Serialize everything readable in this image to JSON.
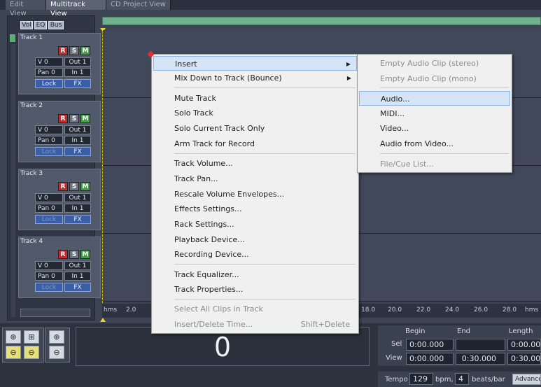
{
  "tabs": [
    {
      "label": "Edit View",
      "active": false
    },
    {
      "label": "Multitrack View",
      "active": true
    },
    {
      "label": "CD Project View",
      "active": false
    }
  ],
  "panel_buttons": [
    "Vol",
    "EQ",
    "Bus"
  ],
  "tracks": [
    {
      "name": "Track 1",
      "vol": "V 0",
      "out": "Out 1",
      "pan": "Pan 0",
      "in": "In 1",
      "lock": "Lock",
      "fx": "FX"
    },
    {
      "name": "Track 2",
      "vol": "V 0",
      "out": "Out 1",
      "pan": "Pan 0",
      "in": "In 1",
      "lock": "Lock",
      "fx": "FX"
    },
    {
      "name": "Track 3",
      "vol": "V 0",
      "out": "Out 1",
      "pan": "Pan 0",
      "in": "In 1",
      "lock": "Lock",
      "fx": "FX"
    },
    {
      "name": "Track 4",
      "vol": "V 0",
      "out": "Out 1",
      "pan": "Pan 0",
      "in": "In 1",
      "lock": "Lock",
      "fx": "FX"
    }
  ],
  "rsm": {
    "r": "R",
    "s": "S",
    "m": "M"
  },
  "ruler": {
    "unit": "hms",
    "ticks_left": [
      "2.0"
    ],
    "ticks_right": [
      "18.0",
      "20.0",
      "22.0",
      "24.0",
      "26.0",
      "28.0"
    ],
    "unit_right": "hms"
  },
  "time_display": "0",
  "selection": {
    "headers": [
      "Begin",
      "End",
      "Length"
    ],
    "sel_label": "Sel",
    "view_label": "View",
    "sel_begin": "0:00.000",
    "sel_end": "",
    "sel_length": "0:00.00",
    "view_begin": "0:00.000",
    "view_end": "0:30.000",
    "view_length": "0:30.00"
  },
  "tempo": {
    "label": "Tempo",
    "bpm": "129",
    "bpm_unit": "bpm,",
    "beats": "4",
    "beats_unit": "beats/bar",
    "advanced": "Advance"
  },
  "context_menu": {
    "items": [
      {
        "label": "Insert",
        "submenu": true,
        "highlighted": true
      },
      {
        "label": "Mix Down to Track (Bounce)",
        "submenu": true
      },
      {
        "sep": true
      },
      {
        "label": "Mute Track"
      },
      {
        "label": "Solo Track"
      },
      {
        "label": "Solo Current Track Only"
      },
      {
        "label": "Arm Track for Record"
      },
      {
        "sep": true
      },
      {
        "label": "Track Volume..."
      },
      {
        "label": "Track Pan..."
      },
      {
        "label": "Rescale Volume Envelopes..."
      },
      {
        "label": "Effects Settings..."
      },
      {
        "label": "Rack Settings..."
      },
      {
        "label": "Playback Device..."
      },
      {
        "label": "Recording Device..."
      },
      {
        "sep": true
      },
      {
        "label": "Track Equalizer..."
      },
      {
        "label": "Track Properties..."
      },
      {
        "sep": true
      },
      {
        "label": "Select All Clips in Track",
        "disabled": true
      },
      {
        "label": "Insert/Delete Time...",
        "disabled": true,
        "shortcut": "Shift+Delete"
      }
    ]
  },
  "submenu": {
    "items": [
      {
        "label": "Empty Audio Clip (stereo)",
        "disabled": true
      },
      {
        "label": "Empty Audio Clip (mono)",
        "disabled": true
      },
      {
        "sep": true
      },
      {
        "label": "Audio...",
        "highlighted": true
      },
      {
        "label": "MIDI..."
      },
      {
        "label": "Video..."
      },
      {
        "label": "Audio from Video..."
      },
      {
        "sep": true
      },
      {
        "label": "File/Cue List...",
        "disabled": true
      }
    ]
  }
}
